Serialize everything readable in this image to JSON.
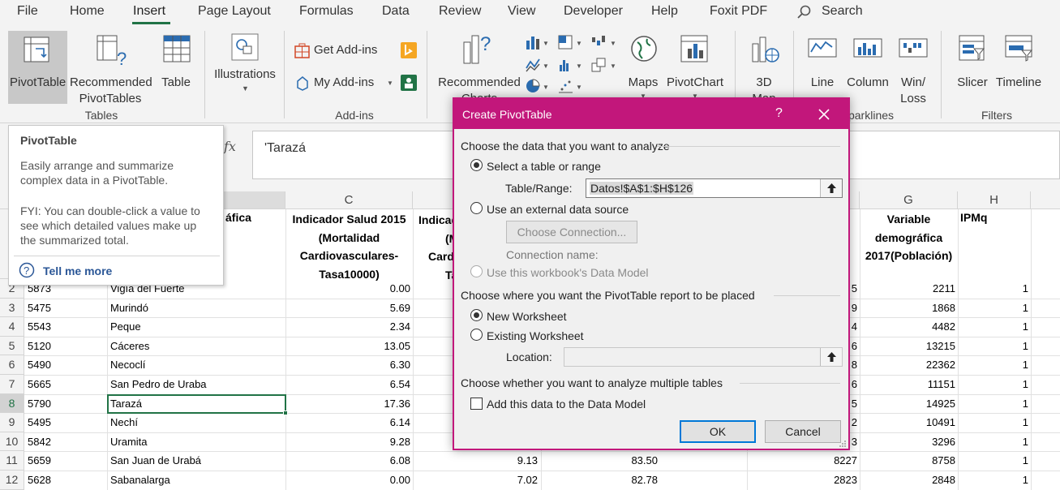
{
  "menu": [
    "File",
    "Home",
    "Insert",
    "Page Layout",
    "Formulas",
    "Data",
    "Review",
    "View",
    "Developer",
    "Help",
    "Foxit PDF"
  ],
  "search_label": "Search",
  "ribbon": {
    "tables": {
      "pivottable": "PivotTable",
      "recommended_l1": "Recommended",
      "recommended_l2": "PivotTables",
      "table": "Table",
      "group": "Tables"
    },
    "illustrations": {
      "label": "Illustrations"
    },
    "addins": {
      "get": "Get Add-ins",
      "my": "My Add-ins",
      "group": "Add-ins"
    },
    "charts": {
      "recommended_l1": "Recommended",
      "recommended_l2": "Charts",
      "maps": "Maps",
      "pivotchart": "PivotChart",
      "map3d_l1": "3D",
      "map3d_l2": "Map"
    },
    "sparklines": {
      "line": "Line",
      "column": "Column",
      "winloss_l1": "Win/",
      "winloss_l2": "Loss",
      "group": "parklines"
    },
    "filters": {
      "slicer": "Slicer",
      "timeline": "Timeline",
      "group": "Filters"
    }
  },
  "formula_bar": {
    "fx": "fx",
    "value": "'Tarazá"
  },
  "tooltip": {
    "title": "PivotTable",
    "desc": "Easily arrange and summarize complex data in a PivotTable.",
    "fyi": "FYI: You can double-click a value to see which detailed values make up the summarized total.",
    "link": "Tell me more"
  },
  "columns": [
    "C",
    "G",
    "H"
  ],
  "headers": {
    "b_partial": "áfica",
    "c": "Indicador Salud 2015 (Mortalidad Cardiovasculares-Tasa10000)",
    "d_l1": "Indicad",
    "d_l2": "(M",
    "d_l3": "Card",
    "d_l4": "Ta",
    "g": "Variable demográfica 2017(Población)",
    "h": "IPMq"
  },
  "rows": [
    {
      "n": "2",
      "a": "5873",
      "b": "Vigía del Fuerte",
      "c": "0.00",
      "d": "",
      "e": "",
      "f": "5",
      "g": "2211",
      "h": "1"
    },
    {
      "n": "3",
      "a": "5475",
      "b": "Murindó",
      "c": "5.69",
      "d": "",
      "e": "",
      "f": "9",
      "g": "1868",
      "h": "1"
    },
    {
      "n": "4",
      "a": "5543",
      "b": "Peque",
      "c": "2.34",
      "d": "",
      "e": "",
      "f": "4",
      "g": "4482",
      "h": "1"
    },
    {
      "n": "5",
      "a": "5120",
      "b": "Cáceres",
      "c": "13.05",
      "d": "",
      "e": "",
      "f": "6",
      "g": "13215",
      "h": "1"
    },
    {
      "n": "6",
      "a": "5490",
      "b": "Necoclí",
      "c": "6.30",
      "d": "",
      "e": "",
      "f": "8",
      "g": "22362",
      "h": "1"
    },
    {
      "n": "7",
      "a": "5665",
      "b": "San Pedro de Uraba",
      "c": "6.54",
      "d": "",
      "e": "",
      "f": "6",
      "g": "11151",
      "h": "1"
    },
    {
      "n": "8",
      "a": "5790",
      "b": "Tarazá",
      "c": "17.36",
      "d": "",
      "e": "",
      "f": "5",
      "g": "14925",
      "h": "1"
    },
    {
      "n": "9",
      "a": "5495",
      "b": "Nechí",
      "c": "6.14",
      "d": "",
      "e": "",
      "f": "2",
      "g": "10491",
      "h": "1"
    },
    {
      "n": "10",
      "a": "5842",
      "b": "Uramita",
      "c": "9.28",
      "d": "",
      "e": "",
      "f": "3",
      "g": "3296",
      "h": "1"
    },
    {
      "n": "11",
      "a": "5659",
      "b": "San Juan de Urabá",
      "c": "6.08",
      "d": "9.13",
      "e": "83.50",
      "f": "8227",
      "g": "8758",
      "h": "1"
    },
    {
      "n": "12",
      "a": "5628",
      "b": "Sabanalarga",
      "c": "0.00",
      "d": "7.02",
      "e": "82.78",
      "f": "2823",
      "g": "2848",
      "h": "1"
    }
  ],
  "dialog": {
    "title": "Create PivotTable",
    "help": "?",
    "section1": "Choose the data that you want to analyze",
    "opt_select": "Select a table or range",
    "table_range_label": "Table/Range:",
    "table_range_value": "Datos!$A$1:$H$126",
    "opt_external": "Use an external data source",
    "choose_connection": "Choose Connection...",
    "connection_name": "Connection name:",
    "opt_datamodel": "Use this workbook's Data Model",
    "section2": "Choose where you want the PivotTable report to be placed",
    "opt_new": "New Worksheet",
    "opt_existing": "Existing Worksheet",
    "location_label": "Location:",
    "location_value": "",
    "section3": "Choose whether you want to analyze multiple tables",
    "add_datamodel": "Add this data to the Data Model",
    "ok": "OK",
    "cancel": "Cancel"
  },
  "colors": {
    "accent": "#217346",
    "dialog": "#c2177b",
    "link": "#2b5797",
    "selection": "#217346"
  }
}
